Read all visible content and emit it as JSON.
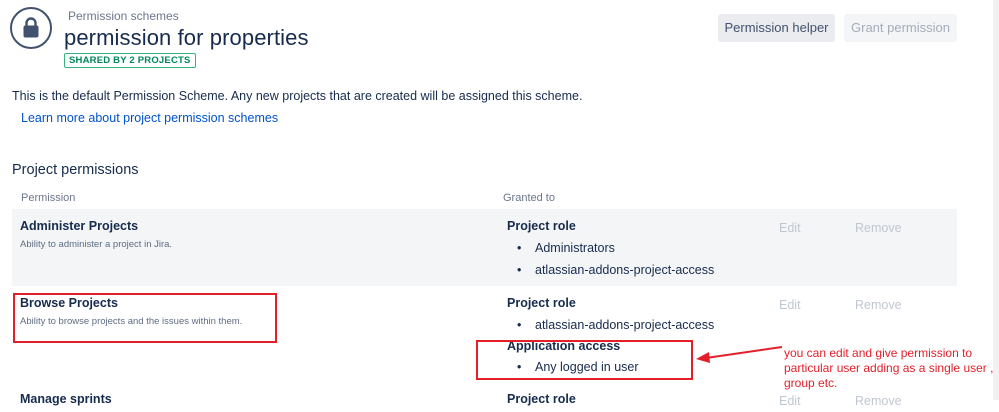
{
  "header": {
    "breadcrumb": "Permission schemes",
    "title": "permission for properties",
    "shared_badge": "SHARED BY 2 PROJECTS",
    "buttons": {
      "permission_helper": "Permission helper",
      "grant_permission": "Grant permission"
    }
  },
  "description": {
    "text": "This is the default Permission Scheme. Any new projects that are created will be assigned this scheme.",
    "learn_more_link": "Learn more about project permission schemes"
  },
  "permissions_section": {
    "title": "Project permissions",
    "columns": {
      "permission": "Permission",
      "granted_to": "Granted to"
    },
    "rows": [
      {
        "name": "Administer Projects",
        "description": "Ability to administer a project in Jira.",
        "groups": [
          {
            "title": "Project role",
            "items": [
              "Administrators",
              "atlassian-addons-project-access"
            ]
          }
        ],
        "edit_label": "Edit",
        "remove_label": "Remove"
      },
      {
        "name": "Browse Projects",
        "description": "Ability to browse projects and the issues within them.",
        "groups": [
          {
            "title": "Project role",
            "items": [
              "atlassian-addons-project-access"
            ]
          },
          {
            "title": "Application access",
            "items": [
              "Any logged in user"
            ]
          }
        ],
        "edit_label": "Edit",
        "remove_label": "Remove"
      },
      {
        "name": "Manage sprints",
        "groups": [
          {
            "title": "Project role",
            "items": []
          }
        ],
        "edit_label": "Edit",
        "remove_label": "Remove"
      }
    ]
  },
  "annotation": {
    "note": "you can edit and give permission to particular user adding as a single user , group etc.",
    "color": "#e3202a"
  },
  "colors": {
    "link": "#0052cc",
    "badge_green": "#00875a",
    "row_shade": "#f4f5f7",
    "text": "#172b4d"
  },
  "icons": {
    "avatar": "lock-icon"
  }
}
